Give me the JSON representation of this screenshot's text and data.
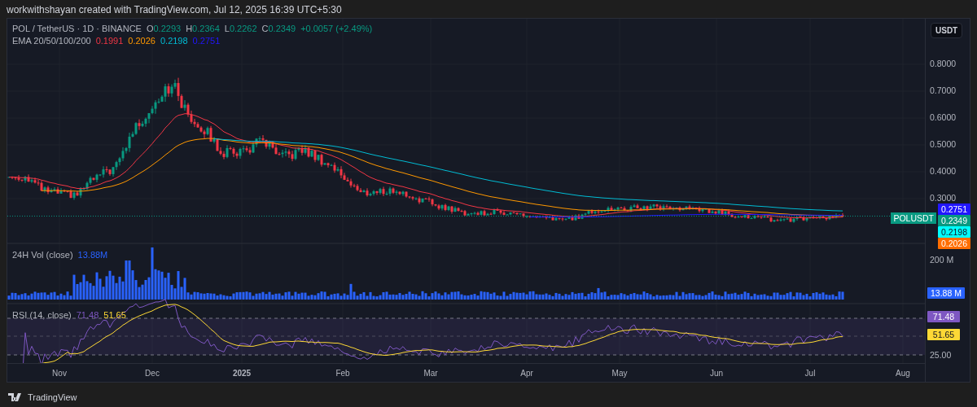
{
  "attribution": "workwithshayan created with TradingView.com, Jul 12, 2025 16:39 UTC+5:30",
  "symbol": {
    "title": "POL / TetherUS · 1D · BINANCE",
    "ohlc": [
      {
        "label": "O",
        "value": "0.2293"
      },
      {
        "label": "H",
        "value": "0.2364"
      },
      {
        "label": "L",
        "value": "0.2262"
      },
      {
        "label": "C",
        "value": "0.2349"
      }
    ],
    "change": "+0.0057 (+2.49%)"
  },
  "ema": {
    "label": "EMA 20/50/100/200",
    "values": [
      {
        "value": "0.1991",
        "color": "#f23645"
      },
      {
        "value": "0.2026",
        "color": "#ff9800"
      },
      {
        "value": "0.2198",
        "color": "#00bcd4"
      },
      {
        "value": "0.2751",
        "color": "#2116ff"
      }
    ]
  },
  "currency_button": "USDT",
  "price_axis": [
    "0.8000",
    "0.7000",
    "0.6000",
    "0.5000",
    "0.4000",
    "0.3000"
  ],
  "price_tags": [
    {
      "value": "0.2751",
      "color": "#2116ff"
    },
    {
      "value": "0.2349",
      "color": "#089981",
      "symbol": "POLUSDT"
    },
    {
      "value": "0.2198",
      "color": "#00ffff"
    },
    {
      "value": "0.2026",
      "color": "#ff6d00"
    }
  ],
  "volume": {
    "label": "24H Vol (close)",
    "value": "13.88M",
    "axis": "200 M",
    "tag": "13.88 M"
  },
  "rsi": {
    "label": "RSI (14, close)",
    "value": "71.48",
    "average": "51.65",
    "axis": "25.00",
    "tags": [
      {
        "value": "71.48",
        "color": "#7e57c2"
      },
      {
        "value": "51.65",
        "color": "#fdd835"
      }
    ]
  },
  "time_axis": [
    {
      "label": "Nov",
      "bold": false
    },
    {
      "label": "Dec",
      "bold": false
    },
    {
      "label": "2025",
      "bold": true
    },
    {
      "label": "Feb",
      "bold": false
    },
    {
      "label": "Mar",
      "bold": false
    },
    {
      "label": "Apr",
      "bold": false
    },
    {
      "label": "May",
      "bold": false
    },
    {
      "label": "Jun",
      "bold": false
    },
    {
      "label": "Jul",
      "bold": false
    },
    {
      "label": "Aug",
      "bold": false
    }
  ],
  "footer": "TradingView"
}
